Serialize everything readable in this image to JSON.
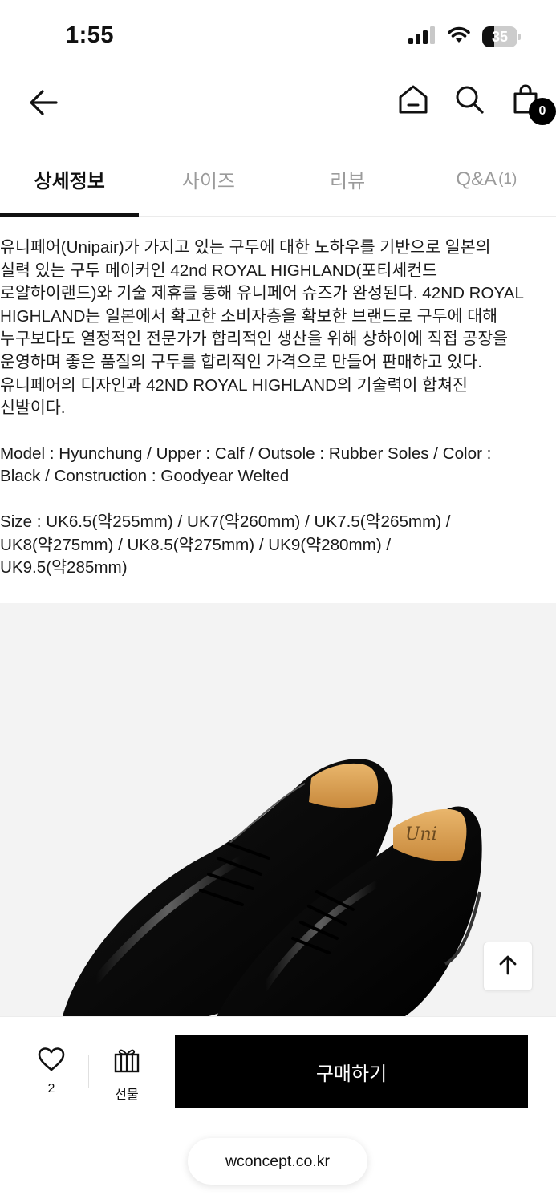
{
  "status_bar": {
    "time": "1:55",
    "battery_level": "35",
    "battery_fraction": 0.35
  },
  "header": {
    "cart_count": "0",
    "icons": [
      "back-arrow-icon",
      "home-icon",
      "search-icon",
      "shopping-bag-icon"
    ]
  },
  "tabs": [
    {
      "label": "상세정보",
      "count": "",
      "active": true
    },
    {
      "label": "사이즈",
      "count": "",
      "active": false
    },
    {
      "label": "리뷰",
      "count": "",
      "active": false
    },
    {
      "label": "Q&A",
      "count": "(1)",
      "active": false
    }
  ],
  "description": {
    "paragraph_1_lines": [
      "유니페어(Unipair)가 가지고 있는 구두에 대한 노하우를 기반으로 일본의",
      "실력 있는 구두 메이커인 42nd ROYAL HIGHLAND(포티세컨드",
      "로얄하이랜드)와 기술 제휴를 통해 유니페어 슈즈가 완성된다. 42ND ROYAL",
      "HIGHLAND는 일본에서 확고한 소비자층을 확보한 브랜드로 구두에 대해",
      "누구보다도 열정적인 전문가가 합리적인 생산을 위해 상하이에 직접 공장을",
      "운영하며 좋은 품질의 구두를 합리적인 가격으로 만들어 판매하고 있다.",
      "유니페어의 디자인과 42ND ROYAL HIGHLAND의 기술력이 합쳐진",
      "신발이다."
    ],
    "paragraph_2_lines": [
      "Model : Hyunchung / Upper : Calf / Outsole : Rubber Soles / Color :",
      "Black / Construction : Goodyear Welted"
    ],
    "paragraph_3_lines": [
      "Size : UK6.5(약255mm) / UK7(약260mm) / UK7.5(약265mm) /",
      "UK8(약275mm) / UK8.5(약275mm) / UK9(약280mm) /",
      "UK9.5(약285mm)"
    ]
  },
  "product_image": {
    "logo_text": "Uni",
    "icon": "scroll-to-top-arrow-icon"
  },
  "bottom_bar": {
    "like_count": "2",
    "gift_label": "선물",
    "buy_label": "구매하기",
    "url": "wconcept.co.kr"
  },
  "colors": {
    "primary": "#000000",
    "background": "#ffffff",
    "inactive_tab": "#9b9b9b",
    "image_background": "#f3f3f3"
  }
}
